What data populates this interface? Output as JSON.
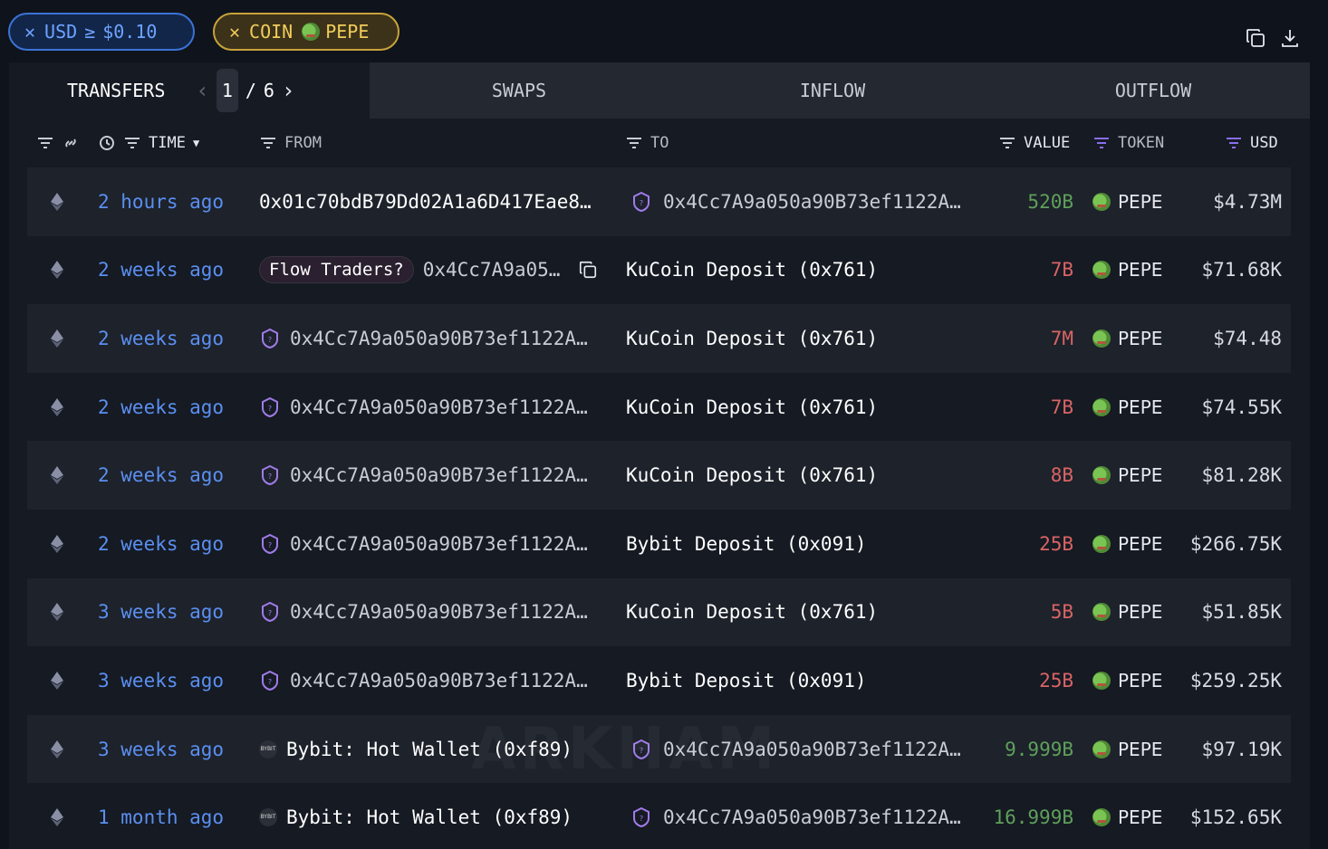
{
  "filters": {
    "usd": {
      "label": "USD",
      "op": "≥",
      "value": "$0.10"
    },
    "coin": {
      "label": "COIN",
      "value": "PEPE"
    }
  },
  "tabs": {
    "transfers": "TRANSFERS",
    "page_current": "1",
    "page_sep": "/",
    "page_total": "6",
    "swaps": "SWAPS",
    "inflow": "INFLOW",
    "outflow": "OUTFLOW"
  },
  "columns": {
    "time": "TIME",
    "from": "FROM",
    "to": "TO",
    "value": "VALUE",
    "token": "TOKEN",
    "usd": "USD"
  },
  "watermark": "ARKHAM",
  "rows": [
    {
      "time": "2 hours ago",
      "from_type": "addr",
      "from_text": "0x01c70bdB79Dd02A1a6D417Eae8…",
      "to_type": "ark",
      "to_text": "0x4Cc7A9a050a90B73ef1122A…",
      "value": "520B",
      "dir": "in",
      "token": "PEPE",
      "usd": "$4.73M"
    },
    {
      "time": "2 weeks ago",
      "from_type": "tag",
      "from_tag": "Flow Traders?",
      "from_text": "0x4Cc7A9a05…",
      "to_type": "ent",
      "to_text": "KuCoin Deposit (0x761)",
      "value": "7B",
      "dir": "out",
      "token": "PEPE",
      "usd": "$71.68K"
    },
    {
      "time": "2 weeks ago",
      "from_type": "ark",
      "from_text": "0x4Cc7A9a050a90B73ef1122A…",
      "to_type": "ent",
      "to_text": "KuCoin Deposit (0x761)",
      "value": "7M",
      "dir": "out",
      "token": "PEPE",
      "usd": "$74.48"
    },
    {
      "time": "2 weeks ago",
      "from_type": "ark",
      "from_text": "0x4Cc7A9a050a90B73ef1122A…",
      "to_type": "ent",
      "to_text": "KuCoin Deposit (0x761)",
      "value": "7B",
      "dir": "out",
      "token": "PEPE",
      "usd": "$74.55K"
    },
    {
      "time": "2 weeks ago",
      "from_type": "ark",
      "from_text": "0x4Cc7A9a050a90B73ef1122A…",
      "to_type": "ent",
      "to_text": "KuCoin Deposit (0x761)",
      "value": "8B",
      "dir": "out",
      "token": "PEPE",
      "usd": "$81.28K"
    },
    {
      "time": "2 weeks ago",
      "from_type": "ark",
      "from_text": "0x4Cc7A9a050a90B73ef1122A…",
      "to_type": "ent",
      "to_text": "Bybit Deposit (0x091)",
      "value": "25B",
      "dir": "out",
      "token": "PEPE",
      "usd": "$266.75K"
    },
    {
      "time": "3 weeks ago",
      "from_type": "ark",
      "from_text": "0x4Cc7A9a050a90B73ef1122A…",
      "to_type": "ent",
      "to_text": "KuCoin Deposit (0x761)",
      "value": "5B",
      "dir": "out",
      "token": "PEPE",
      "usd": "$51.85K"
    },
    {
      "time": "3 weeks ago",
      "from_type": "ark",
      "from_text": "0x4Cc7A9a050a90B73ef1122A…",
      "to_type": "ent",
      "to_text": "Bybit Deposit (0x091)",
      "value": "25B",
      "dir": "out",
      "token": "PEPE",
      "usd": "$259.25K"
    },
    {
      "time": "3 weeks ago",
      "from_type": "bybit",
      "from_text": "Bybit: Hot Wallet (0xf89)",
      "to_type": "ark",
      "to_text": "0x4Cc7A9a050a90B73ef1122A…",
      "value": "9.999B",
      "dir": "in",
      "token": "PEPE",
      "usd": "$97.19K"
    },
    {
      "time": "1 month ago",
      "from_type": "bybit",
      "from_text": "Bybit: Hot Wallet (0xf89)",
      "to_type": "ark",
      "to_text": "0x4Cc7A9a050a90B73ef1122A…",
      "value": "16.999B",
      "dir": "in",
      "token": "PEPE",
      "usd": "$152.65K"
    }
  ],
  "bybit_logo_text": "BYBIT",
  "colors": {
    "inflow": "#5fa05a",
    "outflow": "#d96464",
    "time_link": "#5b8ff0",
    "accent_purple": "#8b6cf0"
  }
}
